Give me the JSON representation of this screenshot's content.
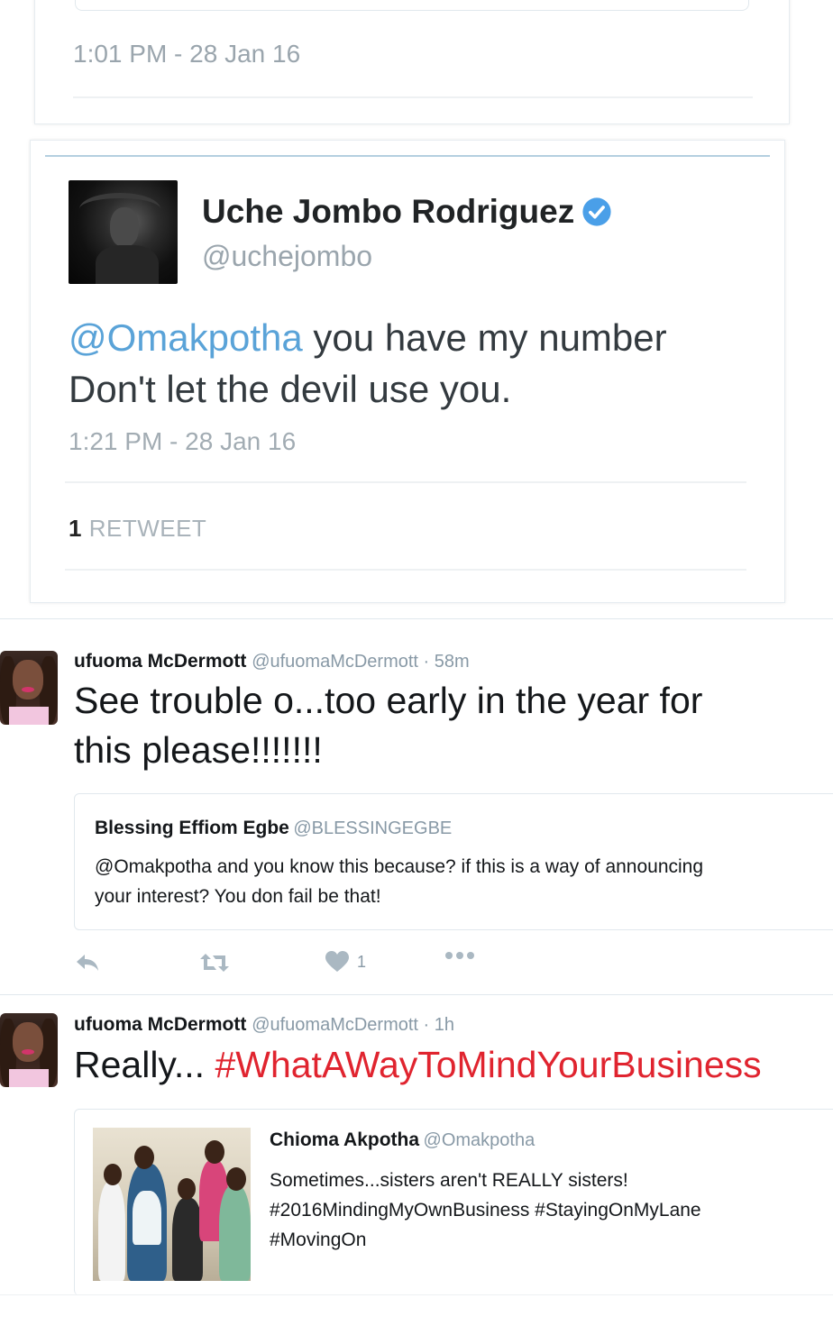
{
  "embed1": {
    "time": "1:01 PM - 28 Jan 16"
  },
  "embed2": {
    "name": "Uche Jombo Rodriguez",
    "handle": "@uchejombo",
    "mention": "@Omakpotha",
    "text_line1_rest": " you have my number",
    "text_line2": "Don't let the devil use you.",
    "time": "1:21 PM - 28 Jan 16",
    "retweet_count": "1",
    "retweet_label": "RETWEET"
  },
  "tweet1": {
    "name": "ufuoma McDermott",
    "handle": "@ufuomaMcDermott",
    "sep": " · ",
    "age": "58m",
    "text_line1": "See trouble o...too early in the year for",
    "text_line2": "this please!!!!!!!",
    "quote": {
      "name": "Blessing Effiom Egbe",
      "handle": "@BLESSINGEGBE",
      "text_line1": "@Omakpotha and you know this because? if this is a way of announcing",
      "text_line2": "your interest? You don fail be that!"
    },
    "likes": "1"
  },
  "tweet2": {
    "name": "ufuoma McDermott",
    "handle": "@ufuomaMcDermott",
    "sep": " · ",
    "age": "1h",
    "text_prefix": "Really... ",
    "hashtag": "#WhatAWayToMindYourBusiness",
    "quote": {
      "name": "Chioma Akpotha",
      "handle": "@Omakpotha",
      "text_line1": "Sometimes...sisters aren't REALLY sisters!",
      "text_line2": "#2016MindingMyOwnBusiness #StayingOnMyLane",
      "text_line3": "#MovingOn"
    }
  },
  "colors": {
    "mention_blue": "#5aa3d8",
    "hashtag_red": "#e0242f",
    "verified_blue": "#4a9fe8",
    "muted_gray": "#8899a6"
  },
  "icons": [
    "verified-icon",
    "reply-icon",
    "retweet-icon",
    "like-icon",
    "more-icon"
  ]
}
